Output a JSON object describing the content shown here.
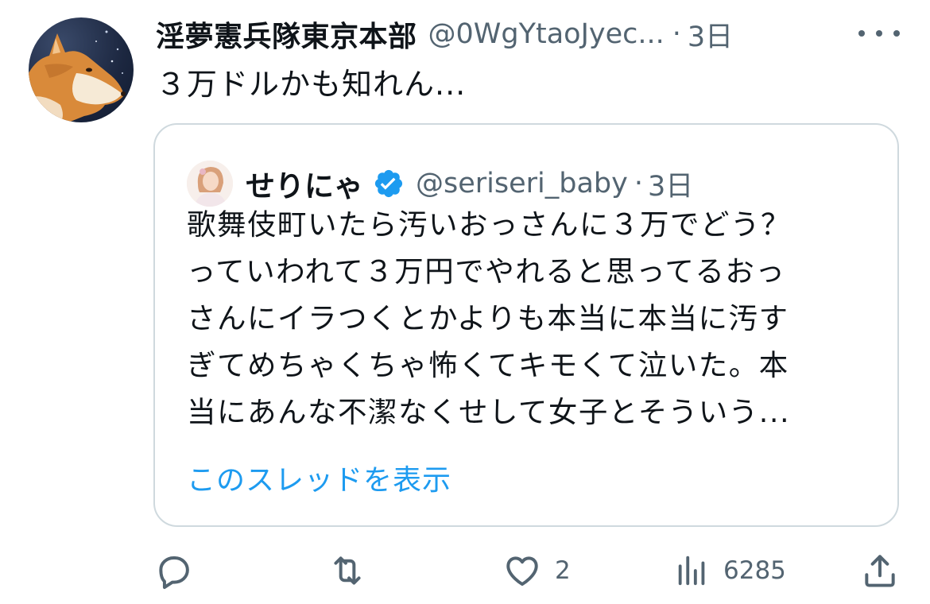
{
  "tweet": {
    "display_name": "淫夢憲兵隊東京本部",
    "handle": "@0WgYtaoJyec...",
    "separator": "·",
    "time": "3日",
    "text": "３万ドルかも知れん..."
  },
  "quoted_tweet": {
    "display_name": "せりにゃ",
    "handle": "@seriseri_baby",
    "separator": "·",
    "time": "3日",
    "body_lines": [
      "歌舞伎町いたら汚いおっさんに３万でどう？",
      "っていわれて３万円でやれると思ってるおっ",
      "さんにイラつくとかよりも本当に本当に汚す",
      "ぎてめちゃくちゃ怖くてキモくて泣いた。本",
      "当にあんな不潔なくせして女子とそういう..."
    ],
    "show_thread": "このスレッドを表示"
  },
  "actions": {
    "reply_icon": "reply-icon",
    "retweet_icon": "retweet-icon",
    "like_icon": "heart-icon",
    "like_count": "2",
    "views_icon": "views-icon",
    "views_count": "6285",
    "share_icon": "share-icon"
  },
  "colors": {
    "text": "#0f1419",
    "secondary": "#536471",
    "link": "#1d9bf0",
    "border": "#cfd9de",
    "verified": "#1d9bf0"
  }
}
